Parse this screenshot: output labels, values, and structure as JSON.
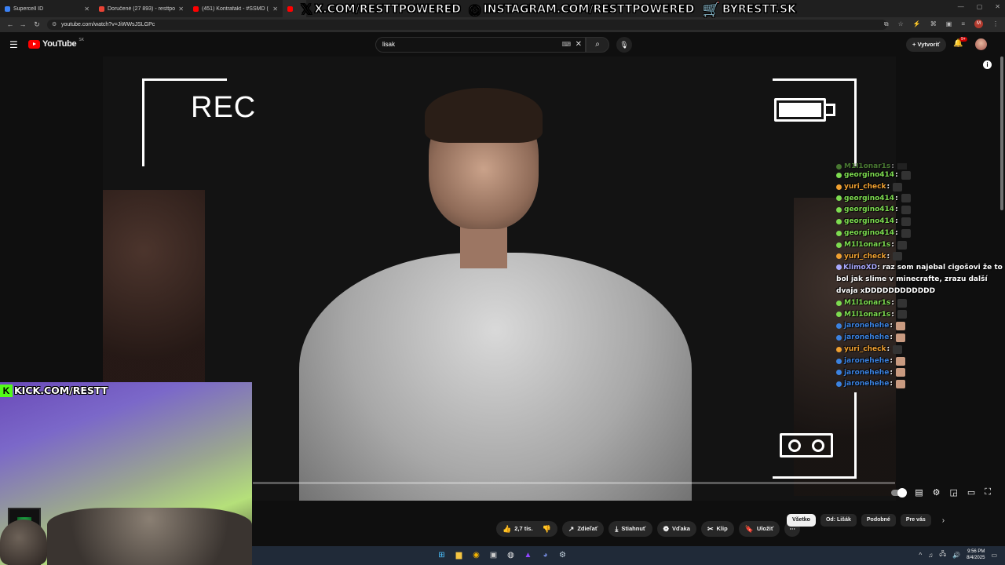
{
  "tabs": [
    {
      "label": "Supercell ID",
      "color": "#3b82f6"
    },
    {
      "label": "Doručené (27 893) - resttpowe",
      "color": "#ea4335"
    },
    {
      "label": "(451) Kontrafakt - #SSMD (",
      "color": "#ff0000"
    },
    {
      "label": "",
      "color": "#ff0000"
    }
  ],
  "overlay": {
    "x": "X.COM/RESTTPOWERED",
    "instagram": "INSTAGRAM.COM/RESTTPOWERED",
    "shop": "BYRESTT.SK"
  },
  "browser": {
    "url": "youtube.com/watch?v=JiWWsJSLGPc",
    "profile_initial": "M"
  },
  "youtube": {
    "logo": "YouTube",
    "region": "SK",
    "search_value": "lisak",
    "create_label": "Vytvoriť",
    "notifications_badge": "9+"
  },
  "video": {
    "rec_text": "REC",
    "progress_fraction": 0.0
  },
  "kick": {
    "logo": "K",
    "text": "KICK.COM/RESTT"
  },
  "chat": [
    {
      "user": "M1l1onar1s",
      "color": "#7ddc50",
      "message": "",
      "partial": true
    },
    {
      "user": "georgino414",
      "color": "#7ddc50",
      "message": ""
    },
    {
      "user": "yuri_check",
      "color": "#f0a030",
      "message": ""
    },
    {
      "user": "georgino414",
      "color": "#7ddc50",
      "message": ""
    },
    {
      "user": "georgino414",
      "color": "#7ddc50",
      "message": ""
    },
    {
      "user": "georgino414",
      "color": "#7ddc50",
      "message": ""
    },
    {
      "user": "georgino414",
      "color": "#7ddc50",
      "message": ""
    },
    {
      "user": "M1l1onar1s",
      "color": "#7ddc50",
      "message": ""
    },
    {
      "user": "yuri_check",
      "color": "#f0a030",
      "message": ""
    },
    {
      "user": "KlimoXD",
      "color": "#a9a9ff",
      "message": "raz som najebal cigošovi že to bol jak slime v minecrafte, zrazu další dvaja xDDDDDDDDDDDD"
    },
    {
      "user": "M1l1onar1s",
      "color": "#7ddc50",
      "message": ""
    },
    {
      "user": "M1l1onar1s",
      "color": "#7ddc50",
      "message": ""
    },
    {
      "user": "jaronehehe",
      "color": "#3b82e0",
      "message": ""
    },
    {
      "user": "jaronehehe",
      "color": "#3b82e0",
      "message": ""
    },
    {
      "user": "yuri_check",
      "color": "#f0a030",
      "message": ""
    },
    {
      "user": "jaronehehe",
      "color": "#3b82e0",
      "message": ""
    },
    {
      "user": "jaronehehe",
      "color": "#3b82e0",
      "message": ""
    },
    {
      "user": "jaronehehe",
      "color": "#3b82e0",
      "message": ""
    }
  ],
  "actions": {
    "like_count": "2,7 tis.",
    "share": "Zdieľať",
    "download": "Stiahnuť",
    "thanks": "Vďaka",
    "clip": "Klip",
    "save": "Uložiť",
    "more": "⋯"
  },
  "chips": [
    "Všetko",
    "Od: Lišák",
    "Podobné",
    "Pre vás"
  ],
  "taskbar": {
    "time": "9:56 PM",
    "date": "8/4/2025"
  }
}
